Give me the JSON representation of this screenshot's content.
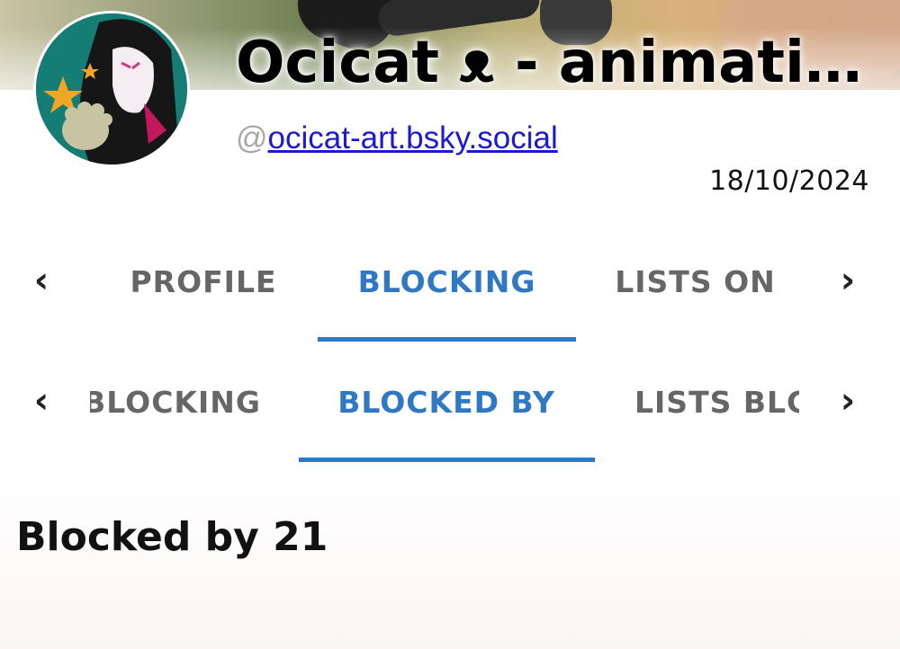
{
  "profile": {
    "display_name": "Ocicat ᴥ - animati…",
    "handle_prefix": "@",
    "handle": "ocicat-art.bsky.social",
    "date": "18/10/2024"
  },
  "nav_primary": {
    "tabs": [
      {
        "label": "PROFILE",
        "active": false
      },
      {
        "label": "BLOCKING",
        "active": true
      },
      {
        "label": "LISTS ON",
        "active": false
      }
    ],
    "prev_icon": "chevron-left-icon",
    "next_icon": "chevron-right-icon"
  },
  "nav_secondary": {
    "tabs": [
      {
        "label": "BLOCKING",
        "active": false
      },
      {
        "label": "BLOCKED BY",
        "active": true
      },
      {
        "label": "LISTS BLC",
        "active": false
      }
    ],
    "prev_icon": "chevron-left-icon",
    "next_icon": "chevron-right-icon"
  },
  "content": {
    "title": "Blocked by 21"
  },
  "colors": {
    "accent": "#2f78c4",
    "inactive_tab": "#666666",
    "link": "#1a1ad6"
  }
}
